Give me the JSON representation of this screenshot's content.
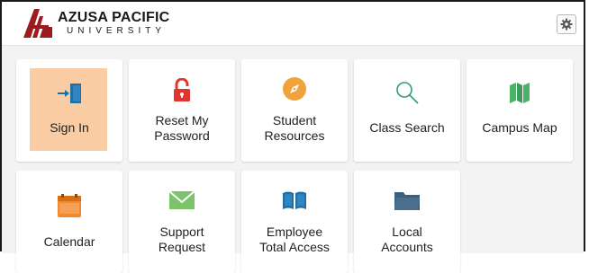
{
  "header": {
    "logo_name": "AZUSA PACIFIC",
    "logo_sub": "UNIVERSITY",
    "settings_icon": "gear-icon"
  },
  "tiles": [
    {
      "label": "Sign In",
      "icon": "sign-in-icon",
      "highlighted": true
    },
    {
      "label": "Reset My Password",
      "line1": "Reset My",
      "line2": "Password",
      "icon": "lock-open-icon"
    },
    {
      "label": "Student Resources",
      "line1": "Student",
      "line2": "Resources",
      "icon": "compass-icon"
    },
    {
      "label": "Class Search",
      "icon": "search-icon"
    },
    {
      "label": "Campus Map",
      "icon": "map-icon"
    },
    {
      "label": "Calendar",
      "icon": "calendar-icon"
    },
    {
      "label": "Support Request",
      "line1": "Support",
      "line2": "Request",
      "icon": "envelope-icon"
    },
    {
      "label": "Employee Total Access",
      "line1": "Employee",
      "line2": "Total Access",
      "icon": "book-icon"
    },
    {
      "label": "Local Accounts",
      "line1": "Local",
      "line2": "Accounts",
      "icon": "folder-icon"
    }
  ],
  "colors": {
    "highlight": "#f9cca4",
    "red": "#e3342f",
    "orange": "#f0a23b",
    "teal": "#2e9c7c",
    "green": "#4cb26a",
    "blue": "#1d6fa5",
    "slate": "#4a6e8c",
    "gray": "#6b6b6b"
  }
}
